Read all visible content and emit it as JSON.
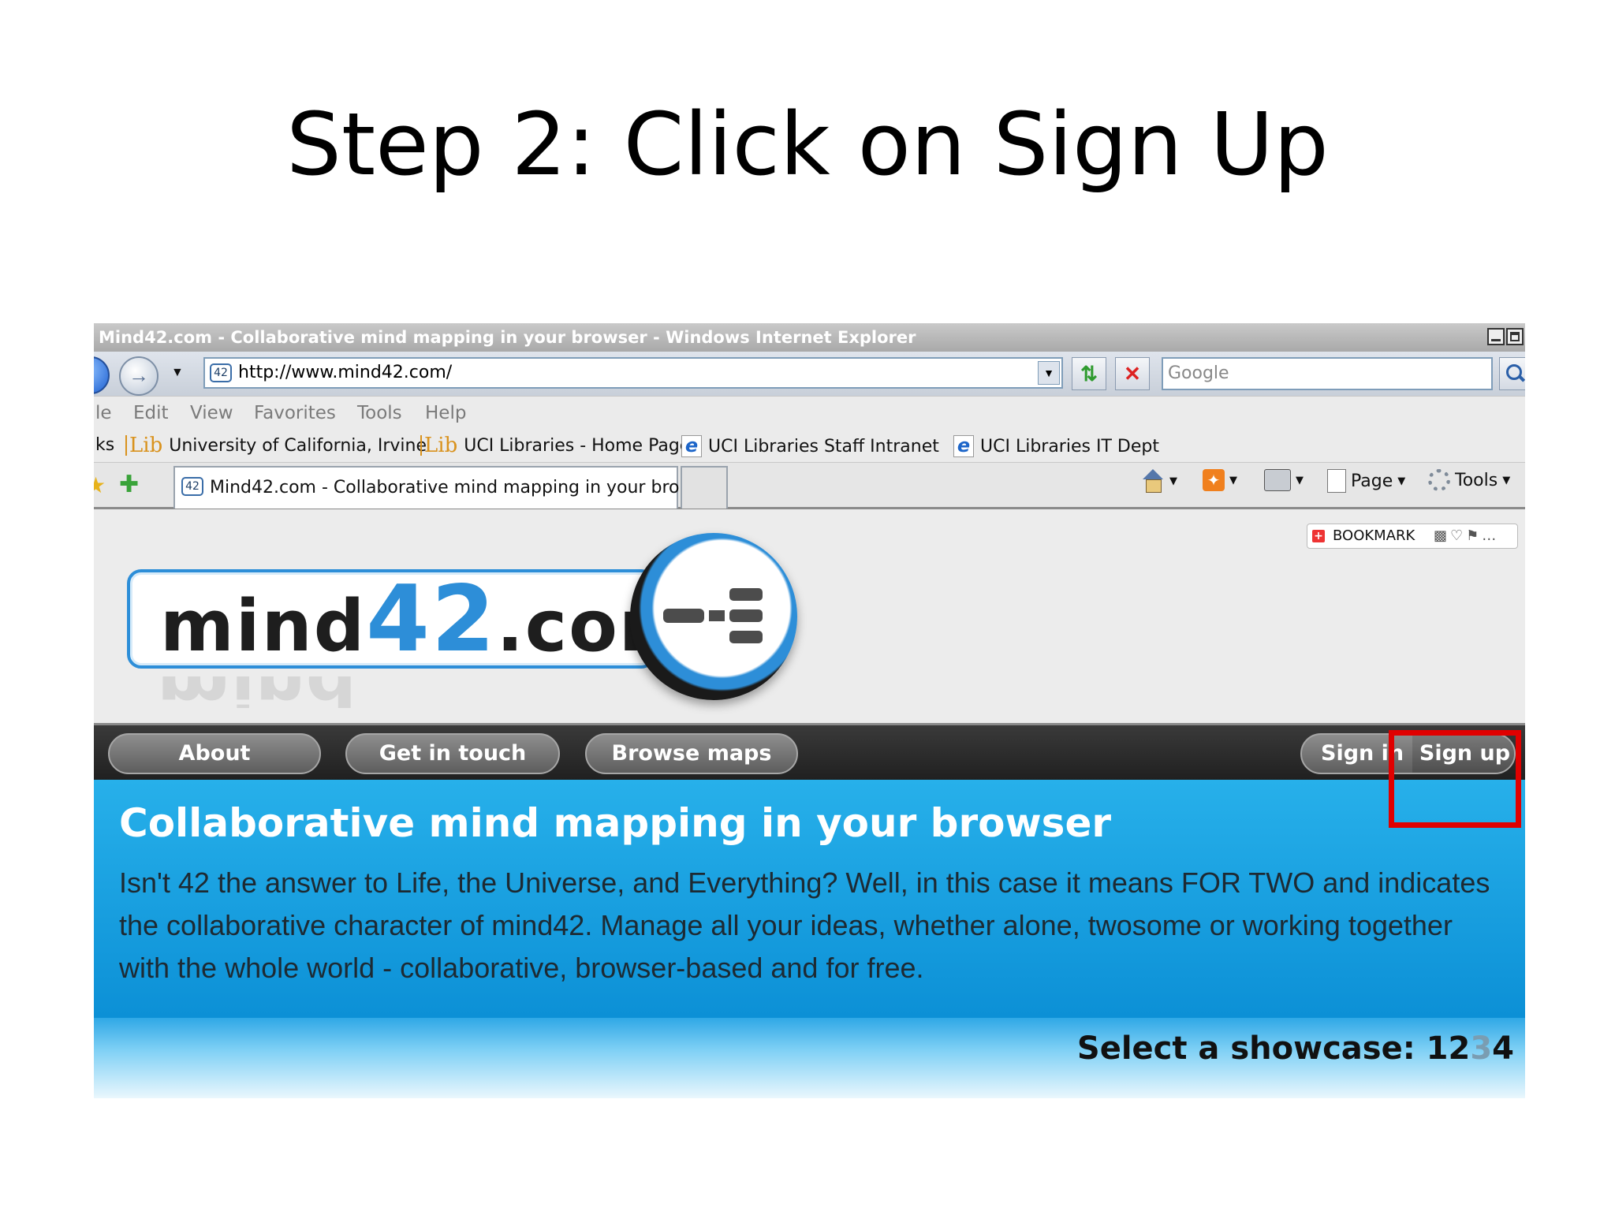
{
  "slide": {
    "title": "Step 2: Click on Sign Up"
  },
  "browser": {
    "window_title": "Mind42.com - Collaborative mind mapping in your browser - Windows Internet Explorer",
    "address": "http://www.mind42.com/",
    "favicon_text": "42",
    "search_placeholder": "Google",
    "menu": [
      "le",
      "Edit",
      "View",
      "Favorites",
      "Tools",
      "Help"
    ],
    "links_prefix": "ks",
    "links": [
      {
        "icon": "lib-icon",
        "label": "University of California, Irvine"
      },
      {
        "icon": "lib-icon",
        "label": "UCI Libraries - Home Page"
      },
      {
        "icon": "ie-page-icon",
        "label": "UCI Libraries Staff Intranet"
      },
      {
        "icon": "ie-page-icon",
        "label": "UCI Libraries IT Dept"
      }
    ],
    "tab_title": "Mind42.com - Collaborative mind mapping in your bro...",
    "commands": {
      "page": "Page",
      "tools": "Tools"
    },
    "lib_glyph": "Lib",
    "ie_glyph": "e"
  },
  "site": {
    "bookmark_label": "BOOKMARK",
    "logo": {
      "prefix": "mind",
      "number": "42",
      "suffix": ".com"
    },
    "nav": {
      "about": "About",
      "contact": "Get in touch",
      "browse": "Browse maps",
      "signin": "Sign in",
      "signup": "Sign up"
    },
    "hero": {
      "title": "Collaborative mind mapping in your browser",
      "body": "Isn't 42 the answer to Life, the Universe, and Everything? Well, in this case it means FOR TWO and indicates the collaborative character of mind42. Manage all your ideas, whether alone, twosome or working together with the whole world - collaborative, browser-based and for free."
    },
    "showcase": {
      "label": "Select a showcase: ",
      "items": [
        "1",
        "2",
        "3",
        "4"
      ],
      "active": "3"
    }
  },
  "colors": {
    "accent_blue": "#2d8ed8",
    "hero_blue": "#1aa2e2",
    "highlight_red": "#e00000",
    "navbar_dark": "#2a2a2a"
  }
}
